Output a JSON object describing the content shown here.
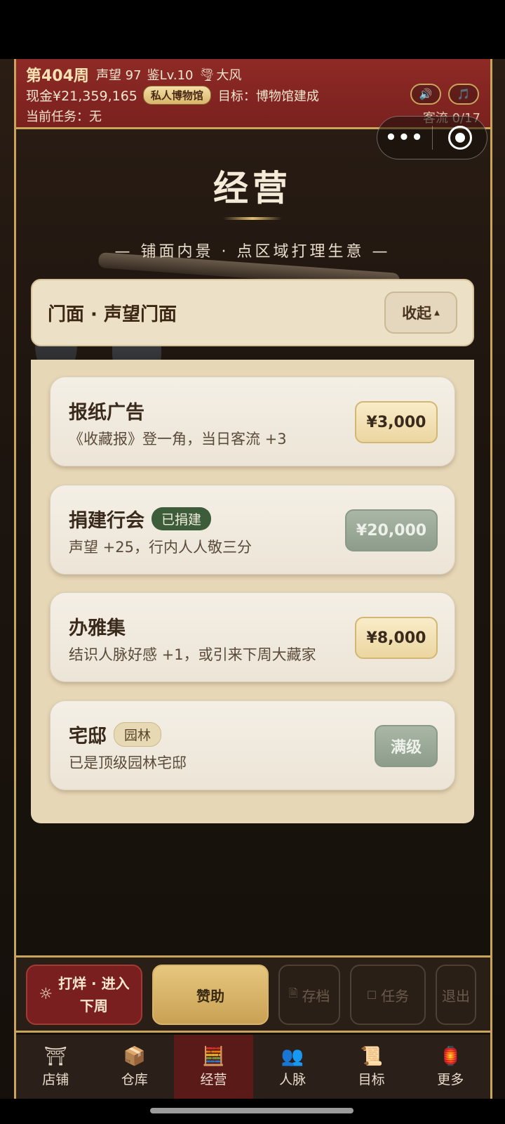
{
  "hud": {
    "week": "第404周",
    "reputation": "声望 97",
    "appraise": "鉴Lv.10",
    "weather_icon": "🌪",
    "weather": "大风",
    "cash": "现金¥21,359,165",
    "museum_badge": "私人博物馆",
    "goal": "目标：博物馆建成",
    "task": "当前任务：无",
    "traffic": "客流 0/17",
    "sound_icon": "🔊",
    "music_icon": "🎵"
  },
  "capsule": {
    "more": "•••"
  },
  "page": {
    "title": "经营",
    "subtitle": "— 铺面内景 · 点区域打理生意 —"
  },
  "section": {
    "title": "门面 · 声望门面",
    "collapse": "收起",
    "caret": "▲"
  },
  "cards": [
    {
      "title": "报纸广告",
      "desc": "《收藏报》登一角，当日客流 +3",
      "price": "¥3,000"
    },
    {
      "title": "捐建行会",
      "tag": "已捐建",
      "desc": "声望 +25，行内人人敬三分",
      "price": "¥20,000"
    },
    {
      "title": "办雅集",
      "desc": "结识人脉好感 +1，或引来下周大藏家",
      "price": "¥8,000"
    },
    {
      "title": "宅邸",
      "tag": "园林",
      "desc": "已是顶级园林宅邸",
      "price": "满级"
    }
  ],
  "actions": {
    "next_line1": "打烊 · 进入",
    "next_line2": "下周",
    "sun_icon": "☼",
    "sponsor": "赞助",
    "save": "存档",
    "save_icon": "🗎",
    "task": "任务",
    "task_icon": "☐",
    "exit": "退出"
  },
  "tabs": [
    {
      "label": "店铺",
      "icon": "⛩"
    },
    {
      "label": "仓库",
      "icon": "📦"
    },
    {
      "label": "经营",
      "icon": "🧮"
    },
    {
      "label": "人脉",
      "icon": "👥"
    },
    {
      "label": "目标",
      "icon": "📜"
    },
    {
      "label": "更多",
      "icon": "🏮"
    }
  ]
}
